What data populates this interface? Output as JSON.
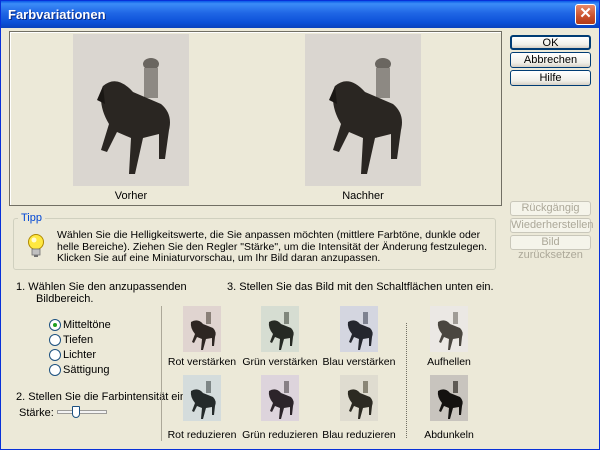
{
  "window": {
    "title": "Farbvariationen",
    "close_glyph": "✕"
  },
  "preview": {
    "before_label": "Vorher",
    "after_label": "Nachher"
  },
  "buttons": {
    "ok": "OK",
    "cancel": "Abbrechen",
    "help": "Hilfe",
    "undo": "Rückgängig",
    "redo": "Wiederherstellen",
    "reset": "Bild zurücksetzen"
  },
  "tip": {
    "legend": "Tipp",
    "text": "Wählen Sie die Helligkeitswerte, die Sie anpassen möchten (mittlere Farbtöne, dunkle oder helle Bereiche). Ziehen Sie den Regler \"Stärke\", um die Intensität der Änderung festzulegen. Klicken Sie auf eine Miniaturvorschau, um Ihr Bild daran anzupassen."
  },
  "step1": {
    "label_line1": "1. Wählen Sie den anzupassenden",
    "label_line2": "Bildbereich.",
    "options": [
      "Mitteltöne",
      "Tiefen",
      "Lichter",
      "Sättigung"
    ],
    "selected": "Mitteltöne"
  },
  "step2": {
    "label": "2. Stellen Sie die Farbintensität ein.",
    "strength_label": "Stärke:",
    "strength_level": 0.4
  },
  "step3": {
    "label": "3. Stellen Sie das Bild mit den Schaltflächen unten ein."
  },
  "variations": {
    "red_increase": "Rot verstärken",
    "green_increase": "Grün verstärken",
    "blue_increase": "Blau verstärken",
    "lighten": "Aufhellen",
    "red_decrease": "Rot reduzieren",
    "green_decrease": "Grün reduzieren",
    "blue_decrease": "Blau reduzieren",
    "darken": "Abdunkeln"
  },
  "colors": {
    "titlebar": "#0a50d8",
    "dialog_bg": "#ece9d8",
    "tip_legend": "#0046d5",
    "radio_dot": "#21a121"
  }
}
